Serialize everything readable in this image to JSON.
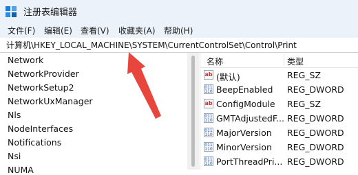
{
  "window": {
    "title": "注册表编辑器"
  },
  "menu": [
    "文件(F)",
    "编辑(E)",
    "查看(V)",
    "收藏夹(A)",
    "帮助(H)"
  ],
  "address": {
    "path": "计算机\\HKEY_LOCAL_MACHINE\\SYSTEM\\CurrentControlSet\\Control\\Print"
  },
  "tree": [
    "Network",
    "NetworkProvider",
    "NetworkSetup2",
    "NetworkUxManager",
    "Nls",
    "NodeInterfaces",
    "Notifications",
    "Nsi",
    "NUMA"
  ],
  "values_pane": {
    "header": {
      "name": "名称",
      "type": "类型"
    },
    "rows": [
      {
        "name": "(默认)",
        "type": "REG_SZ",
        "icon": "string-value-icon"
      },
      {
        "name": "BeepEnabled",
        "type": "REG_DWORD",
        "icon": "binary-value-icon"
      },
      {
        "name": "ConfigModule",
        "type": "REG_SZ",
        "icon": "string-value-icon"
      },
      {
        "name": "GMTAdjustedF...",
        "type": "REG_DWORD",
        "icon": "binary-value-icon"
      },
      {
        "name": "MajorVersion",
        "type": "REG_DWORD",
        "icon": "binary-value-icon"
      },
      {
        "name": "MinorVersion",
        "type": "REG_DWORD",
        "icon": "binary-value-icon"
      },
      {
        "name": "PortThreadPri...",
        "type": "REG_DWORD",
        "icon": "binary-value-icon"
      }
    ]
  },
  "annotation": {
    "arrow_color": "#e8453c"
  }
}
